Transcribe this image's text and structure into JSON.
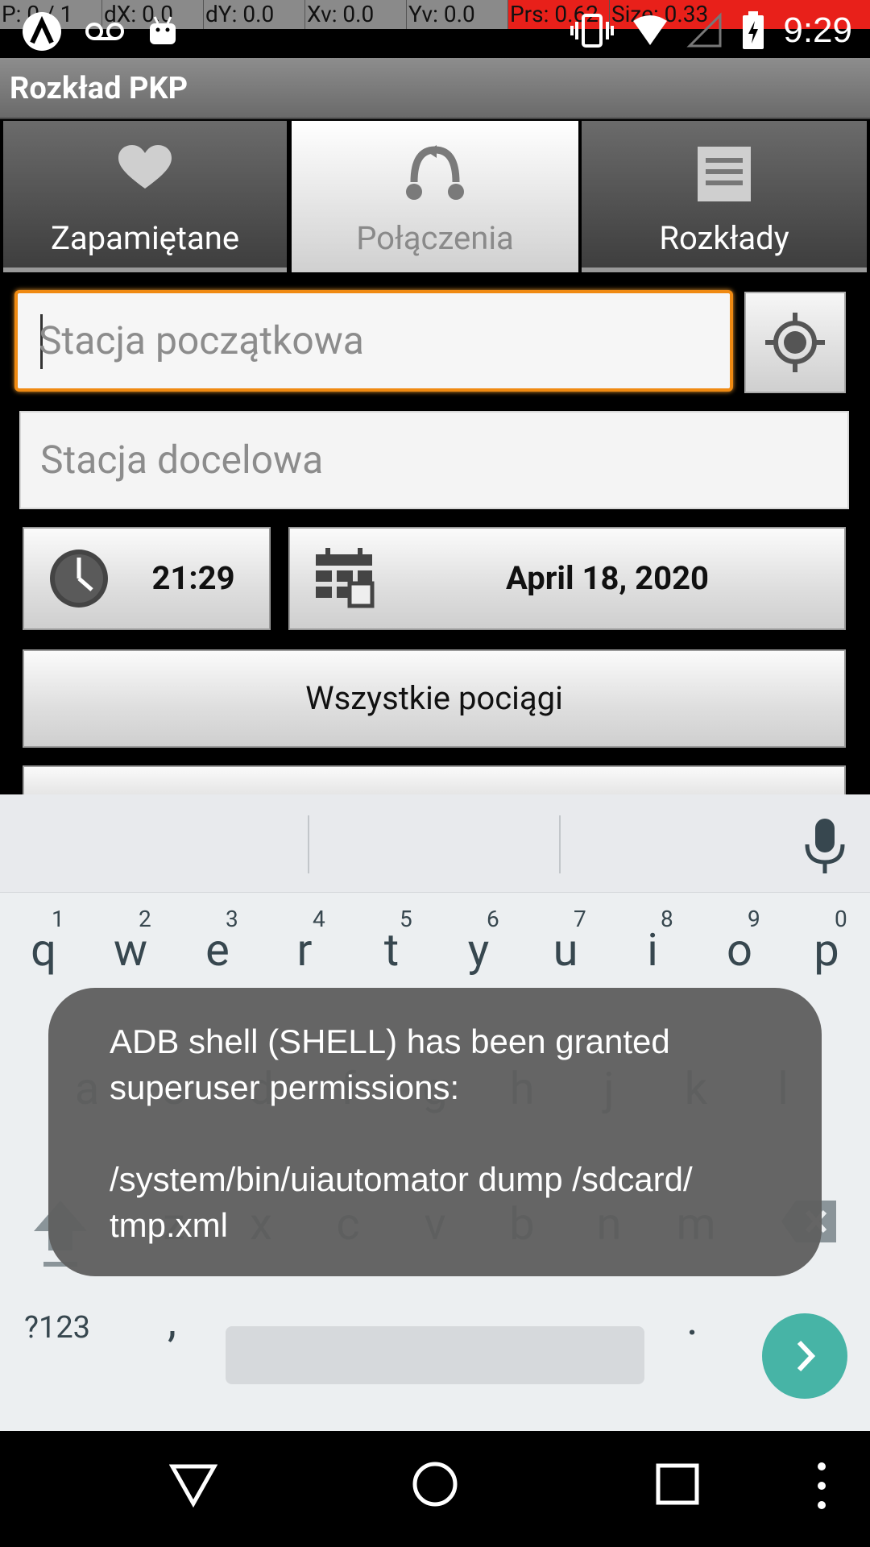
{
  "debug_overlay": {
    "pointer": "P: 0 / 1",
    "dx": "dX: 0.0",
    "dy": "dY: 0.0",
    "xv": "Xv: 0.0",
    "yv": "Yv: 0.0",
    "pressure": "Prs: 0.62",
    "size": "Size: 0.33"
  },
  "status_bar": {
    "time": "9:29",
    "icons_left": [
      "android-debug-icon",
      "voicemail-icon",
      "android-icon"
    ],
    "icons_right": [
      "vibrate-icon",
      "wifi-icon",
      "no-signal-icon",
      "battery-charging-icon"
    ]
  },
  "app": {
    "title": "Rozkład PKP"
  },
  "tabs": [
    {
      "label": "Zapamiętane",
      "icon": "heart-icon",
      "active": false
    },
    {
      "label": "Połączenia",
      "icon": "connection-icon",
      "active": true
    },
    {
      "label": "Rozkłady",
      "icon": "list-icon",
      "active": false
    }
  ],
  "form": {
    "start_station": {
      "placeholder": "Stacja początkowa",
      "value": ""
    },
    "destination_station": {
      "placeholder": "Stacja docelowa",
      "value": ""
    },
    "locate_button_icon": "gps-target-icon",
    "time": "21:29",
    "date": "April 18, 2020",
    "all_trains_label": "Wszystkie pociągi"
  },
  "keyboard": {
    "row1": [
      {
        "ch": "q",
        "hint": "1"
      },
      {
        "ch": "w",
        "hint": "2"
      },
      {
        "ch": "e",
        "hint": "3"
      },
      {
        "ch": "r",
        "hint": "4"
      },
      {
        "ch": "t",
        "hint": "5"
      },
      {
        "ch": "y",
        "hint": "6"
      },
      {
        "ch": "u",
        "hint": "7"
      },
      {
        "ch": "i",
        "hint": "8"
      },
      {
        "ch": "o",
        "hint": "9"
      },
      {
        "ch": "p",
        "hint": "0"
      }
    ],
    "row2": [
      "a",
      "s",
      "d",
      "f",
      "g",
      "h",
      "j",
      "k",
      "l"
    ],
    "row3": [
      "z",
      "x",
      "c",
      "v",
      "b",
      "n",
      "m"
    ],
    "symbols_key": "?123",
    "comma_key": ",",
    "period_key": "."
  },
  "toast": {
    "message": "ADB shell (SHELL) has been granted\nsuperuser permissions:\n\n/system/bin/uiautomator dump /sdcard/\ntmp.xml"
  },
  "colors": {
    "focus_orange": "#f08a12",
    "go_key_teal": "#47b4a6",
    "debug_red": "#e8201a"
  }
}
